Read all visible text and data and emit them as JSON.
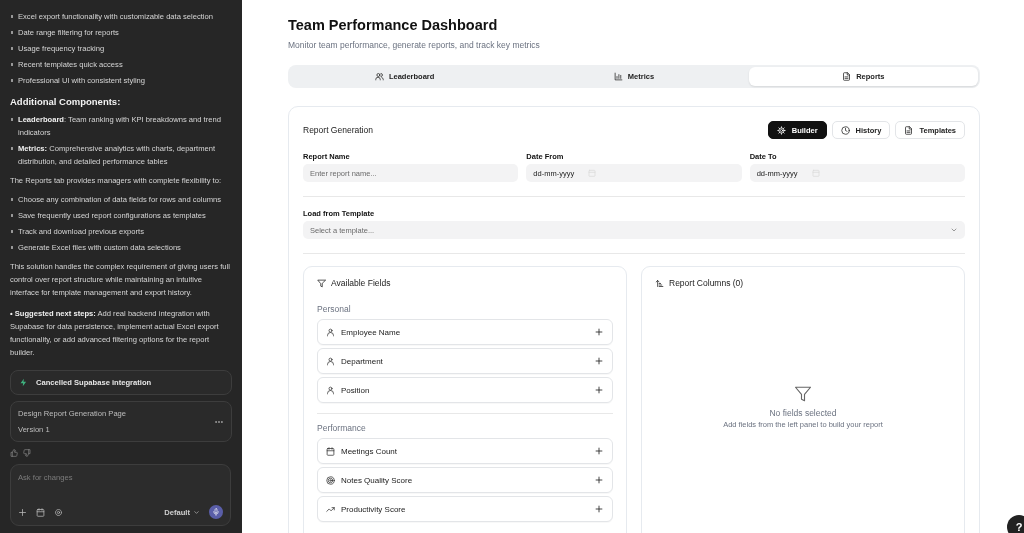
{
  "chat": {
    "feature_bullets": [
      "Excel export functionality with customizable data selection",
      "Date range filtering for reports",
      "Usage frequency tracking",
      "Recent templates quick access",
      "Professional UI with consistent styling"
    ],
    "heading": "Additional Components:",
    "components": [
      "**Leaderboard**: Team ranking with KPI breakdowns and trend indicators",
      "**Metrics:** Comprehensive analytics with charts, department distribution, and detailed performance tables"
    ],
    "intro": "The Reports tab provides managers with complete flexibility to:",
    "flex_bullets": [
      "Choose any combination of data fields for rows and columns",
      "Save frequently used report configurations as templates",
      "Track and download previous exports",
      "Generate Excel files with custom data selections"
    ],
    "summary": "This solution handles the complex requirement of giving users full control over report structure while maintaining an intuitive interface for template management and export history.",
    "next_steps": "**• Suggested next steps:** Add real backend integration with Supabase for data persistence, implement actual Excel export functionality, or add advanced filtering options for the report builder.",
    "status": {
      "label": "Cancelled Supabase integration"
    },
    "version_card": {
      "title": "Design Report Generation Page",
      "version": "Version 1"
    },
    "composer": {
      "placeholder": "Ask for changes",
      "mode": "Default"
    }
  },
  "dashboard": {
    "title": "Team Performance Dashboard",
    "subtitle": "Monitor team performance, generate reports, and track key metrics",
    "tabs": [
      {
        "label": "Leaderboard",
        "kind": "users",
        "selected": false
      },
      {
        "label": "Metrics",
        "kind": "chart",
        "selected": false
      },
      {
        "label": "Reports",
        "kind": "file",
        "selected": true
      }
    ],
    "report": {
      "title": "Report Generation",
      "view_buttons": [
        {
          "label": "Builder",
          "kind": "gear",
          "selected": true
        },
        {
          "label": "History",
          "kind": "clock",
          "selected": false
        },
        {
          "label": "Templates",
          "kind": "file",
          "selected": false
        }
      ],
      "fields": [
        {
          "label": "Report Name",
          "kind": "text",
          "placeholder": "Enter report name..."
        },
        {
          "label": "Date From",
          "kind": "date",
          "value": "dd-mm-yyyy"
        },
        {
          "label": "Date To",
          "kind": "date",
          "value": "dd-mm-yyyy"
        }
      ],
      "template": {
        "label": "Load from Template",
        "placeholder": "Select a template..."
      },
      "available": {
        "title": "Available Fields",
        "groups": [
          {
            "name": "Personal",
            "fields": [
              {
                "label": "Employee Name",
                "kind": "person"
              },
              {
                "label": "Department",
                "kind": "person"
              },
              {
                "label": "Position",
                "kind": "person"
              }
            ]
          },
          {
            "name": "Performance",
            "fields": [
              {
                "label": "Meetings Count",
                "kind": "calendar"
              },
              {
                "label": "Notes Quality Score",
                "kind": "target"
              },
              {
                "label": "Productivity Score",
                "kind": "trend"
              }
            ]
          }
        ]
      },
      "columns": {
        "title": "Report Columns (0)",
        "empty_title": "No fields selected",
        "empty_hint": "Add fields from the left panel to build your report"
      }
    }
  },
  "help": {
    "label": "?"
  }
}
